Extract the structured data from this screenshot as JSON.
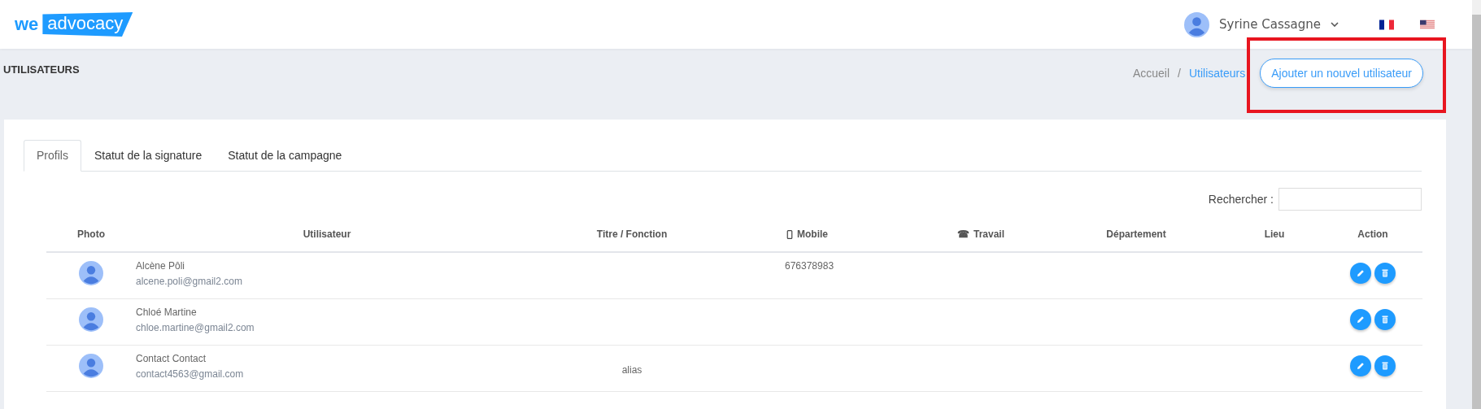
{
  "header": {
    "logo": {
      "left": "we",
      "right": "advocacy"
    },
    "user_name": "Syrine Cassagne",
    "languages": [
      {
        "kind": "fr"
      },
      {
        "kind": "us"
      }
    ]
  },
  "page_title": "UTILISATEURS",
  "breadcrumb": [
    {
      "label": "Accueil",
      "current": false
    },
    {
      "label": "/",
      "current": false
    },
    {
      "label": "Utilisateurs",
      "current": true
    }
  ],
  "add_button": "Ajouter un nouvel utilisateur",
  "tabs": [
    {
      "label": "Profils",
      "selected": true
    },
    {
      "label": "Statut de la signature",
      "selected": false
    },
    {
      "label": "Statut de la campagne",
      "selected": false
    }
  ],
  "search": {
    "label": "Rechercher :"
  },
  "table": {
    "columns": [
      {
        "label": "Photo",
        "kind": "plain"
      },
      {
        "label": "Utilisateur",
        "kind": "plain"
      },
      {
        "label": "Titre / Fonction",
        "kind": "plain"
      },
      {
        "label": "Mobile",
        "kind": "mobile"
      },
      {
        "label": "Travail",
        "kind": "symbol",
        "symbol": "☎"
      },
      {
        "label": "Département",
        "kind": "plain"
      },
      {
        "label": "Lieu",
        "kind": "plain"
      },
      {
        "label": "Action",
        "kind": "plain"
      }
    ],
    "rows": [
      {
        "name": "Alcène Pôli",
        "email": "alcene.poli@gmail2.com",
        "mobile": "676378983"
      },
      {
        "name": "Chloé Martine",
        "email": "chloe.martine@gmail2.com"
      },
      {
        "name": "Contact Contact",
        "email": "contact4563@gmail.com",
        "title": "alias"
      }
    ]
  }
}
